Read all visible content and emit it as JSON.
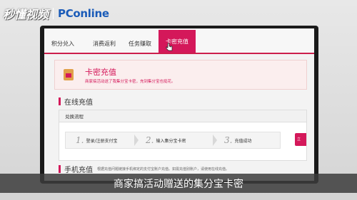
{
  "watermark": {
    "left_text": "秒懂视频",
    "brand_text": "PConline"
  },
  "tabs": [
    {
      "label": "积分兑入",
      "active": false
    },
    {
      "label": "消费返利",
      "active": false
    },
    {
      "label": "任务赚取",
      "active": false
    },
    {
      "label": "卡密充值",
      "active": true
    }
  ],
  "card": {
    "title": "卡密充值",
    "description": "商家搞活动送了我集分宝卡密，充到集分宝也挺花。"
  },
  "online": {
    "title": "在线充值",
    "flow_label": "兑换流程",
    "steps": [
      {
        "num": "1.",
        "label": "登录/注册支付宝"
      },
      {
        "num": "2.",
        "label": "输入集分宝卡密"
      },
      {
        "num": "3.",
        "label": "充值成功"
      }
    ],
    "button_label": "立"
  },
  "phone": {
    "title": "手机充值",
    "description": "根据充值问题链接手机绑定的支付宝账户充值。如需充值别账户，请使用在线充值。"
  },
  "subtitle": "商家搞活动赠送的集分宝卡密",
  "colors": {
    "accent": "#d4185a",
    "card_bg": "#fbeeee",
    "frame": "#d9d9d9"
  }
}
